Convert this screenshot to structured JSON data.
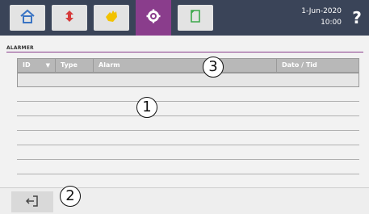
{
  "header": {
    "tabs": [
      {
        "name": "home",
        "icon": "home-icon",
        "color": "#3a74c4"
      },
      {
        "name": "alarms",
        "icon": "arrows-icon",
        "color": "#d63a3a"
      },
      {
        "name": "hand",
        "icon": "hand-icon",
        "color": "#f2c200"
      },
      {
        "name": "settings",
        "icon": "gear-icon",
        "color": "#ffffff",
        "active": true
      },
      {
        "name": "document",
        "icon": "document-icon",
        "color": "#3ca84b"
      }
    ],
    "date": "1-Jun-2020",
    "time": "10:00",
    "help_label": "?"
  },
  "section": {
    "title": "ALARMER"
  },
  "table": {
    "columns": [
      {
        "label": "ID",
        "sort": "▼"
      },
      {
        "label": "Type"
      },
      {
        "label": "Alarm"
      },
      {
        "label": "Dato / Tid"
      }
    ],
    "rows": [
      "",
      "",
      "",
      "",
      "",
      "",
      ""
    ]
  },
  "callouts": {
    "c1": "1",
    "c2": "2",
    "c3": "3"
  },
  "footer": {
    "back_icon": "exit-icon"
  },
  "colors": {
    "header_bg": "#3a4458",
    "accent": "#8a3d8c",
    "table_header": "#b8b8b8"
  }
}
